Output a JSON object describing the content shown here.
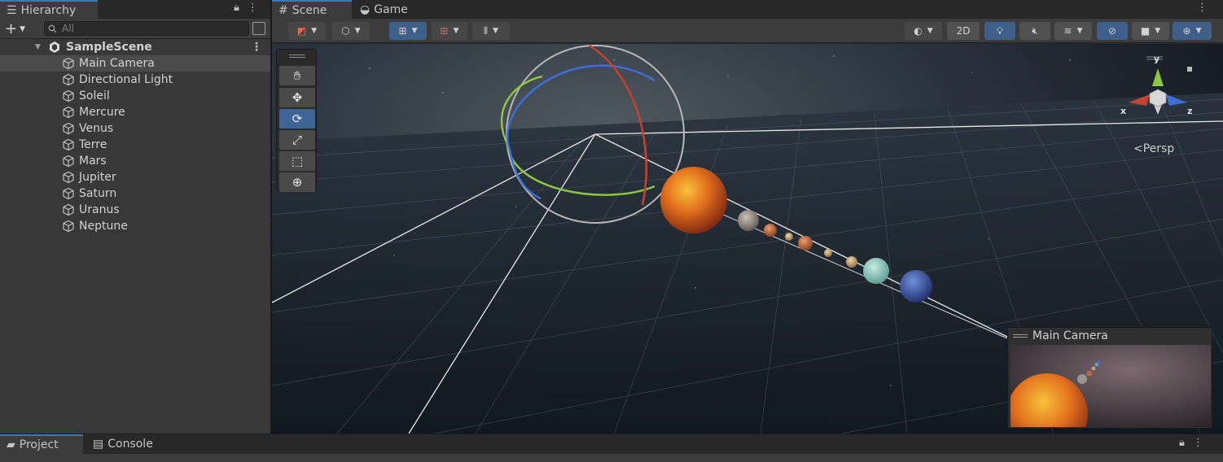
{
  "hierarchy": {
    "tab_label": "Hierarchy",
    "search_placeholder": "All",
    "scene_name": "SampleScene",
    "objects": [
      "Main Camera",
      "Directional Light",
      "Soleil",
      "Mercure",
      "Venus",
      "Terre",
      "Mars",
      "Jupiter",
      "Saturn",
      "Uranus",
      "Neptune"
    ],
    "selected_object": "Main Camera"
  },
  "scene_view": {
    "tabs": [
      "Scene",
      "Game"
    ],
    "active_tab": "Scene",
    "toolbar": {
      "mode_2d_label": "2D"
    },
    "tools": [
      "hand-tool",
      "move-tool",
      "rotate-tool",
      "scale-tool",
      "rect-tool",
      "transform-tool"
    ],
    "active_tool": "rotate-tool",
    "gizmo": {
      "x_label": "x",
      "y_label": "y",
      "z_label": "z",
      "projection_label": "Persp"
    },
    "camera_preview_title": "Main Camera"
  },
  "bottom_panel": {
    "tabs": [
      "Project",
      "Console"
    ]
  },
  "colors": {
    "accent": "#3a79bb",
    "selection": "#4b4b4b",
    "panel": "#383838",
    "gizmo_x": "#c8412e",
    "gizmo_y": "#8ec63f",
    "gizmo_z": "#3d6fd6"
  }
}
